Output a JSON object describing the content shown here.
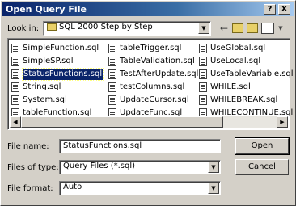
{
  "window": {
    "title": "Open Query File",
    "help_button": "?",
    "close_button": "X"
  },
  "look_in": {
    "label": "Look in:",
    "value": "SQL 2000 Step by Step"
  },
  "files": {
    "col1": [
      {
        "name": "SimpleFunction.sql"
      },
      {
        "name": "SimpleSP.sql"
      },
      {
        "name": "StatusFunctions.sql",
        "selected": true
      },
      {
        "name": "String.sql"
      },
      {
        "name": "System.sql"
      },
      {
        "name": "tableFunction.sql"
      }
    ],
    "col2": [
      {
        "name": "tableTrigger.sql"
      },
      {
        "name": "TableValidation.sql"
      },
      {
        "name": "TestAfterUpdate.sql"
      },
      {
        "name": "testColumns.sql"
      },
      {
        "name": "UpdateCursor.sql"
      },
      {
        "name": "UpdateFunc.sql"
      }
    ],
    "col3": [
      {
        "name": "UseGlobal.sql"
      },
      {
        "name": "UseLocal.sql"
      },
      {
        "name": "UseTableVariable.sql"
      },
      {
        "name": "WHILE.sql"
      },
      {
        "name": "WHILEBREAK.sql"
      },
      {
        "name": "WHILECONTINUE.sql"
      }
    ]
  },
  "file_name": {
    "label": "File name:",
    "value": "StatusFunctions.sql"
  },
  "file_type": {
    "label": "Files of type:",
    "value": "Query Files (*.sql)"
  },
  "file_format": {
    "label": "File format:",
    "value": "Auto"
  },
  "buttons": {
    "open": "Open",
    "cancel": "Cancel"
  }
}
